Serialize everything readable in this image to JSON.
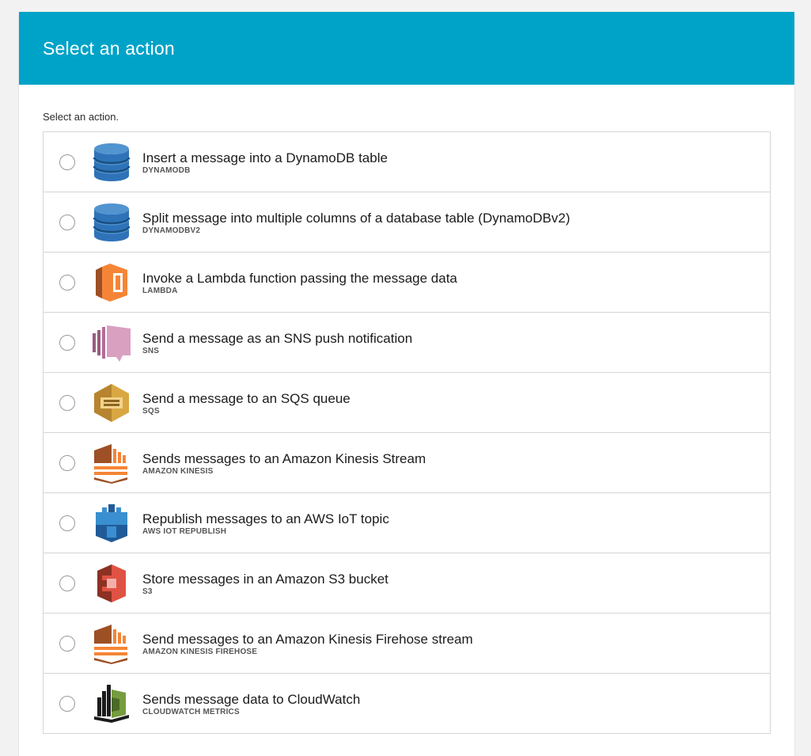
{
  "header": {
    "title": "Select an action"
  },
  "instruction": "Select an action.",
  "actions": [
    {
      "title": "Insert a message into a DynamoDB table",
      "subtitle": "DYNAMODB",
      "icon": "dynamodb-icon"
    },
    {
      "title": "Split message into multiple columns of a database table (DynamoDBv2)",
      "subtitle": "DYNAMODBV2",
      "icon": "dynamodb-icon"
    },
    {
      "title": "Invoke a Lambda function passing the message data",
      "subtitle": "LAMBDA",
      "icon": "lambda-icon"
    },
    {
      "title": "Send a message as an SNS push notification",
      "subtitle": "SNS",
      "icon": "sns-icon"
    },
    {
      "title": "Send a message to an SQS queue",
      "subtitle": "SQS",
      "icon": "sqs-icon"
    },
    {
      "title": "Sends messages to an Amazon Kinesis Stream",
      "subtitle": "AMAZON KINESIS",
      "icon": "kinesis-icon"
    },
    {
      "title": "Republish messages to an AWS IoT topic",
      "subtitle": "AWS IOT REPUBLISH",
      "icon": "iot-icon"
    },
    {
      "title": "Store messages in an Amazon S3 bucket",
      "subtitle": "S3",
      "icon": "s3-icon"
    },
    {
      "title": "Send messages to an Amazon Kinesis Firehose stream",
      "subtitle": "AMAZON KINESIS FIREHOSE",
      "icon": "kinesis-firehose-icon"
    },
    {
      "title": "Sends message data to CloudWatch",
      "subtitle": "CLOUDWATCH METRICS",
      "icon": "cloudwatch-icon"
    }
  ],
  "colors": {
    "header_bg": "#00a3c8",
    "dynamodb": "#2e73b8",
    "lambda": "#f58536",
    "sns": "#d9a0c0",
    "sqs": "#d9a741",
    "kinesis": "#f58536",
    "iot": "#3a8fd0",
    "s3": "#e05243",
    "cloudwatch": "#759c3e"
  }
}
